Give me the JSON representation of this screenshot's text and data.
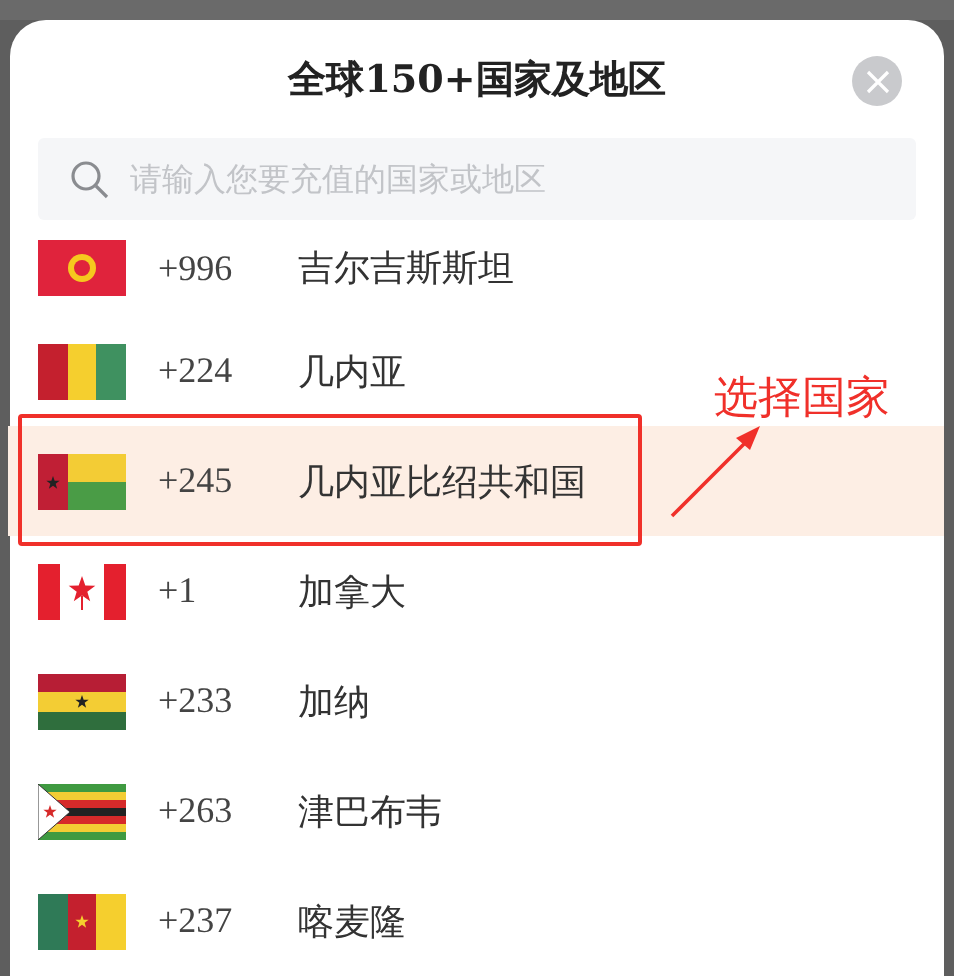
{
  "sheet": {
    "title": "全球150+国家及地区",
    "search": {
      "placeholder": "请输入您要充值的国家或地区"
    }
  },
  "countries": [
    {
      "kind": "kyrgyzstan",
      "code": "+996",
      "name": "吉尔吉斯斯坦",
      "selected": false
    },
    {
      "kind": "guinea",
      "code": "+224",
      "name": "几内亚",
      "selected": false
    },
    {
      "kind": "guinea_bissau",
      "code": "+245",
      "name": "几内亚比绍共和国",
      "selected": true
    },
    {
      "kind": "canada",
      "code": "+1",
      "name": "加拿大",
      "selected": false
    },
    {
      "kind": "ghana",
      "code": "+233",
      "name": "加纳",
      "selected": false
    },
    {
      "kind": "zimbabwe",
      "code": "+263",
      "name": "津巴布韦",
      "selected": false
    },
    {
      "kind": "cameroon",
      "code": "+237",
      "name": "喀麦隆",
      "selected": false
    }
  ],
  "annotation": {
    "text": "选择国家"
  }
}
